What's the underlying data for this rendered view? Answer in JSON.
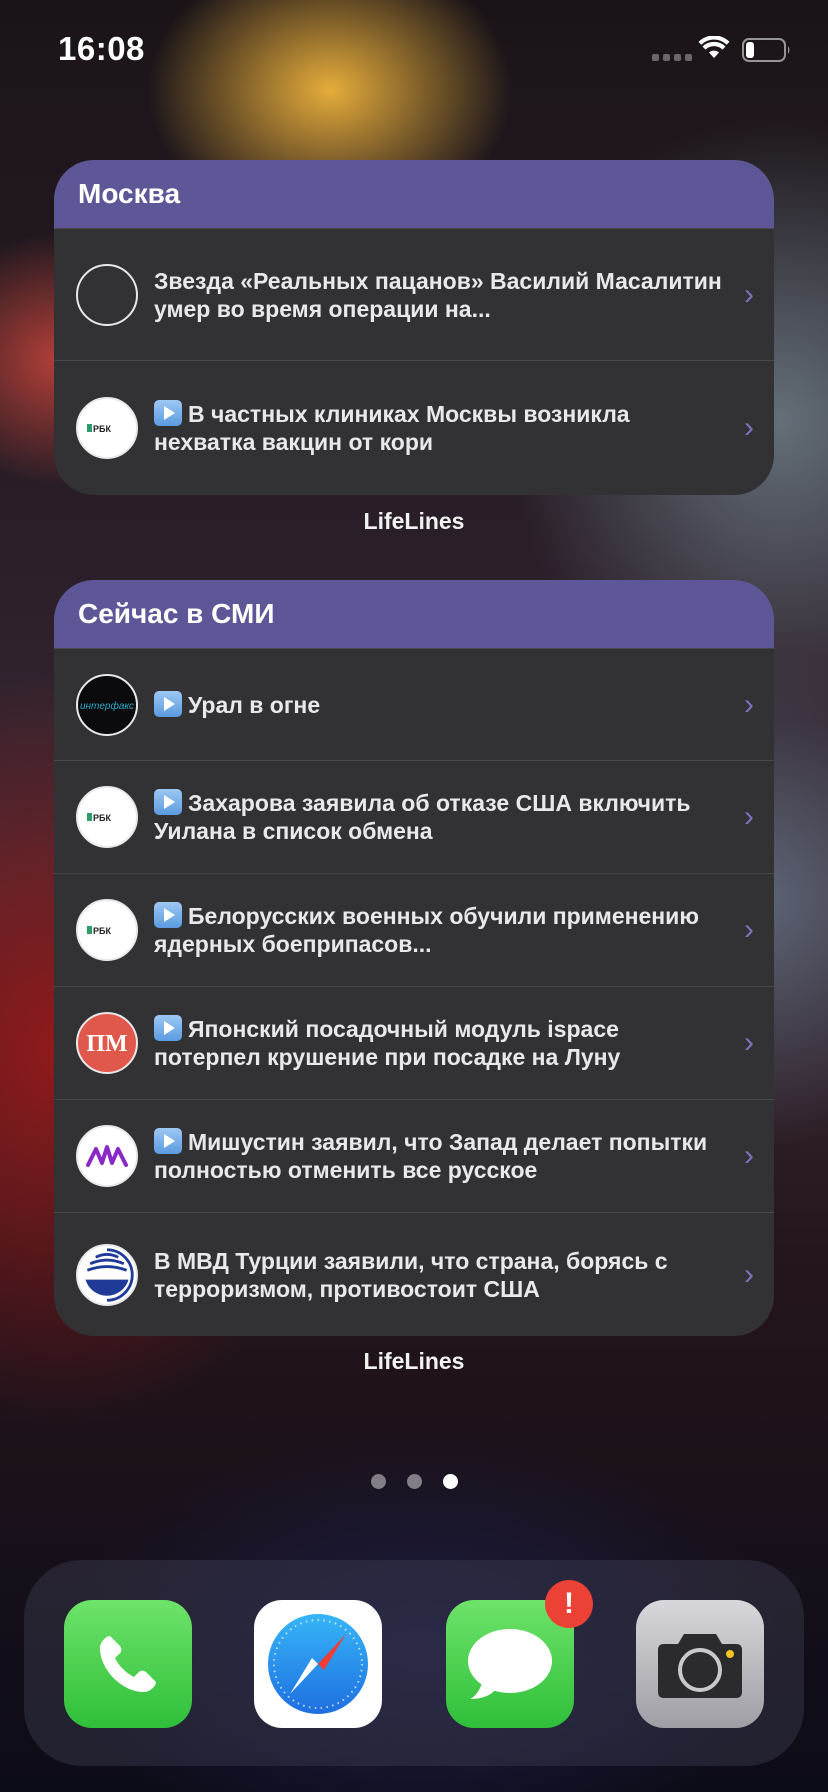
{
  "status_bar": {
    "time": "16:08"
  },
  "widgets": [
    {
      "title": "Москва",
      "label": "LifeLines",
      "items": [
        {
          "text": "Звезда «Реальных пацанов» Василий Масалитин умер во время операции на...",
          "video": false,
          "source_logo": "blank-logo"
        },
        {
          "text": "В частных клиниках Москвы возникла нехватка вакцин от кори",
          "video": true,
          "source_logo": "rbc-logo",
          "source_name": "РБК"
        }
      ]
    },
    {
      "title": "Сейчас в СМИ",
      "label": "LifeLines",
      "items": [
        {
          "text": "Урал в огне",
          "video": true,
          "source_logo": "interfax-logo",
          "source_name": "интерфакс"
        },
        {
          "text": "Захарова заявила об отказе США включить Уилана в список обмена",
          "video": true,
          "source_logo": "rbc-logo",
          "source_name": "РБК"
        },
        {
          "text": "Белорусских военных обучили применению ядерных боеприпасов...",
          "video": true,
          "source_logo": "rbc-logo",
          "source_name": "РБК"
        },
        {
          "text": "Японский посадочный модуль ispace потерпел крушение при посадке на Луну",
          "video": true,
          "source_logo": "pm-logo",
          "source_name": "ПМ"
        },
        {
          "text": "Мишустин заявил, что Запад делает попытки полностью отменить все русское",
          "video": true,
          "source_logo": "wave-logo"
        },
        {
          "text": "В МВД Турции заявили, что страна, борясь с терроризмом, противостоит США",
          "video": false,
          "source_logo": "globe-logo"
        }
      ]
    }
  ],
  "page_indicator": {
    "count": 3,
    "active": 3
  },
  "dock": {
    "apps": [
      {
        "name": "Phone",
        "icon": "phone-icon"
      },
      {
        "name": "Safari",
        "icon": "safari-icon"
      },
      {
        "name": "Messages",
        "icon": "messages-icon",
        "badge": "!"
      },
      {
        "name": "Camera",
        "icon": "camera-icon"
      }
    ]
  },
  "colors": {
    "widget_header": "#5d5798",
    "widget_body": "#323234",
    "chevron": "#7a74c0",
    "badge": "#eb4235"
  }
}
